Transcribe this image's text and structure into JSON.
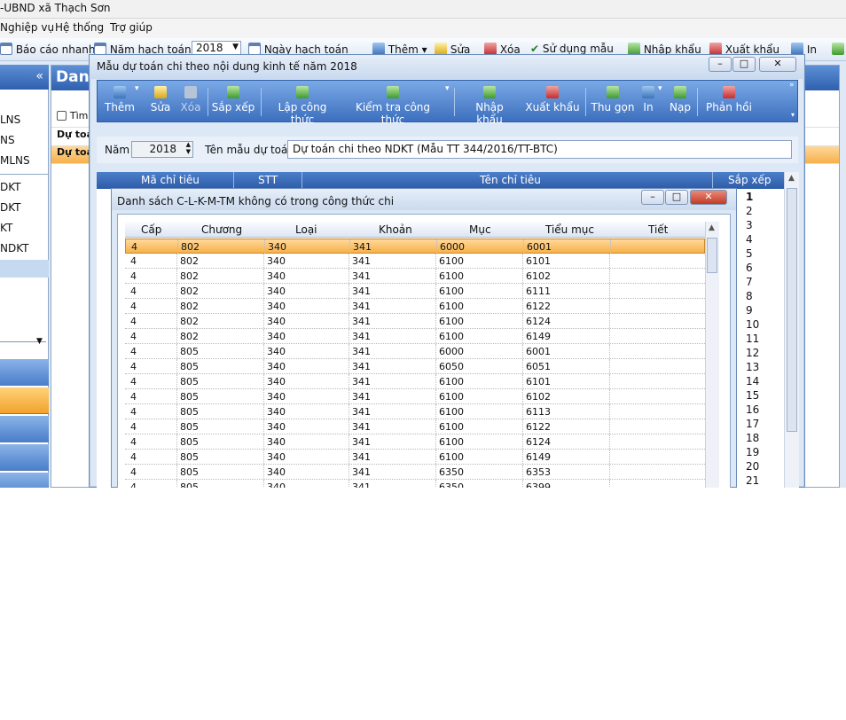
{
  "app": {
    "title": "-UBND xã Thạch Sơn",
    "menu": [
      "Nghiệp vụ",
      "Hệ thống",
      "Trợ giúp"
    ],
    "toolbar": {
      "bao_cao_nhanh": "Báo cáo nhanh",
      "nam_hach_toan": "Năm hạch toán",
      "year_value": "2018",
      "ngay_hach_toan": "Ngày hạch toán",
      "them": "Thêm",
      "sua": "Sửa",
      "xoa": "Xóa",
      "su_dung_mau": "Sử dụng mẫu",
      "nhap_khau": "Nhập khẩu",
      "xuat_khau": "Xuất khẩu",
      "in": "In"
    }
  },
  "left_panel": {
    "collapse_glyph": "«",
    "items": [
      "LNS",
      "NS",
      "MLNS",
      "DKT",
      "DKT",
      "KT",
      "NDKT"
    ]
  },
  "background_panel": {
    "title": "Danh",
    "rows": [
      "Tìm",
      "Dự toá",
      "Dự toá"
    ]
  },
  "dialog_main": {
    "title": "Mẫu dự toán chi theo nội dung kinh tế năm 2018",
    "ribbon": {
      "them": "Thêm",
      "sua": "Sửa",
      "xoa": "Xóa",
      "sap_xep": "Sắp xếp",
      "lap_cong_thuc": "Lập công thức",
      "kiem_tra_cong_thuc": "Kiểm tra công thức",
      "nhap_khau": "Nhập khẩu",
      "xuat_khau": "Xuất khẩu",
      "thu_gon": "Thu gọn",
      "in": "In",
      "nap": "Nạp",
      "phan_hoi": "Phản hồi"
    },
    "filter": {
      "nam_label": "Năm",
      "nam_value": "2018",
      "ten_mau_label": "Tên mẫu dự toán",
      "ten_mau_value": "Dự toán chi theo NDKT (Mẫu TT 344/2016/TT-BTC)"
    },
    "grid_columns": [
      "Mã chỉ tiêu",
      "STT",
      "Tên chỉ tiêu",
      "Sắp xếp"
    ],
    "sap_xep_values": [
      "1",
      "2",
      "3",
      "4",
      "5",
      "6",
      "7",
      "8",
      "9",
      "10",
      "11",
      "12",
      "13",
      "14",
      "15",
      "16",
      "17",
      "18",
      "19",
      "20",
      "21"
    ]
  },
  "dialog_list": {
    "title": "Danh sách C-L-K-M-TM không có trong công thức chi",
    "columns": [
      "Cấp",
      "Chương",
      "Loại",
      "Khoản",
      "Mục",
      "Tiểu mục",
      "Tiết"
    ],
    "rows": [
      [
        "4",
        "802",
        "340",
        "341",
        "6000",
        "6001",
        ""
      ],
      [
        "4",
        "802",
        "340",
        "341",
        "6100",
        "6101",
        ""
      ],
      [
        "4",
        "802",
        "340",
        "341",
        "6100",
        "6102",
        ""
      ],
      [
        "4",
        "802",
        "340",
        "341",
        "6100",
        "6111",
        ""
      ],
      [
        "4",
        "802",
        "340",
        "341",
        "6100",
        "6122",
        ""
      ],
      [
        "4",
        "802",
        "340",
        "341",
        "6100",
        "6124",
        ""
      ],
      [
        "4",
        "802",
        "340",
        "341",
        "6100",
        "6149",
        ""
      ],
      [
        "4",
        "805",
        "340",
        "341",
        "6000",
        "6001",
        ""
      ],
      [
        "4",
        "805",
        "340",
        "341",
        "6050",
        "6051",
        ""
      ],
      [
        "4",
        "805",
        "340",
        "341",
        "6100",
        "6101",
        ""
      ],
      [
        "4",
        "805",
        "340",
        "341",
        "6100",
        "6102",
        ""
      ],
      [
        "4",
        "805",
        "340",
        "341",
        "6100",
        "6113",
        ""
      ],
      [
        "4",
        "805",
        "340",
        "341",
        "6100",
        "6122",
        ""
      ],
      [
        "4",
        "805",
        "340",
        "341",
        "6100",
        "6124",
        ""
      ],
      [
        "4",
        "805",
        "340",
        "341",
        "6100",
        "6149",
        ""
      ],
      [
        "4",
        "805",
        "340",
        "341",
        "6350",
        "6353",
        ""
      ],
      [
        "4",
        "805",
        "340",
        "341",
        "6350",
        "6399",
        ""
      ]
    ]
  }
}
